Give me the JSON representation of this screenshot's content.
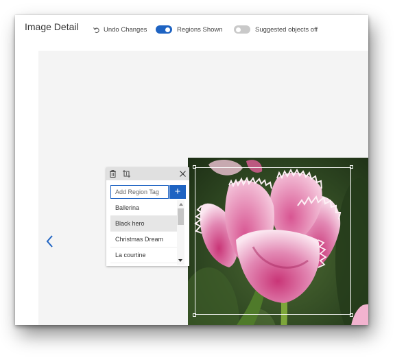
{
  "header": {
    "title": "Image Detail",
    "undo_label": "Undo Changes",
    "regions_toggle": {
      "label": "Regions Shown",
      "on": true
    },
    "suggested_toggle": {
      "label": "Suggested objects off",
      "on": false
    }
  },
  "region_popup": {
    "toolbar_icons": [
      "trash-icon",
      "crop-icon",
      "close-icon"
    ],
    "input_placeholder": "Add Region Tag",
    "add_button_label": "+",
    "tags": [
      "Ballerina",
      "Black hero",
      "Christmas Dream",
      "La courtine"
    ],
    "selected_tag": "Black hero"
  },
  "navigation": {
    "prev_icon": "chevron-left-icon"
  },
  "image": {
    "subject": "pink fringed tulip"
  },
  "colors": {
    "accent": "#1e63c2",
    "toggle_off": "#c9c9c9",
    "popup_toolbar": "#e0e0e0"
  }
}
